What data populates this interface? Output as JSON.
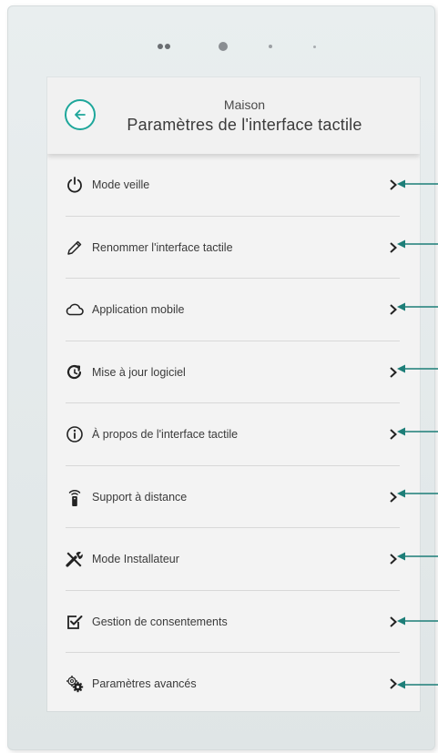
{
  "colors": {
    "accent": "#1ea79b",
    "arrow": "#1d7e78",
    "text": "#3a3a3a"
  },
  "header": {
    "subtitle": "Maison",
    "title": "Paramètres de l'interface tactile",
    "back_icon": "arrow-left-circle-icon"
  },
  "menu": {
    "items": [
      {
        "label": "Mode veille",
        "icon": "power-icon"
      },
      {
        "label": "Renommer l'interface tactile",
        "icon": "pencil-icon"
      },
      {
        "label": "Application mobile",
        "icon": "cloud-icon"
      },
      {
        "label": "Mise à jour logiciel",
        "icon": "refresh-icon"
      },
      {
        "label": "À propos de l'interface tactile",
        "icon": "info-icon"
      },
      {
        "label": "Support à distance",
        "icon": "remote-icon"
      },
      {
        "label": "Mode Installateur",
        "icon": "tools-icon"
      },
      {
        "label": "Gestion de consentements",
        "icon": "checkbox-icon"
      },
      {
        "label": "Paramètres avancés",
        "icon": "gears-icon"
      }
    ]
  }
}
